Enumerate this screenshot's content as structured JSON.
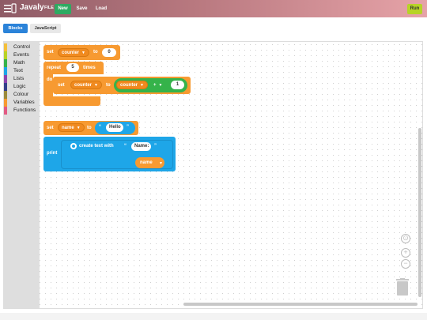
{
  "header": {
    "app_title": "Javaly",
    "file_label": "FILE",
    "new_label": "New",
    "save_label": "Save",
    "load_label": "Load",
    "run_label": "Run",
    "colors": {
      "gradient_start": "#8e5b66",
      "gradient_end": "#e6a3a8",
      "new": "#2eaa62",
      "run": "#b7d326"
    }
  },
  "tabs": {
    "blocks_label": "Blocks",
    "javascript_label": "JavaScript",
    "active": "Blocks"
  },
  "toolbox": {
    "categories": [
      {
        "label": "Control",
        "color": "#f4bf3a"
      },
      {
        "label": "Events",
        "color": "#b8d326"
      },
      {
        "label": "Math",
        "color": "#35b34a"
      },
      {
        "label": "Text",
        "color": "#1ea6e8"
      },
      {
        "label": "Lists",
        "color": "#8e44ad"
      },
      {
        "label": "Logic",
        "color": "#333f8a"
      },
      {
        "label": "Colour",
        "color": "#9b8b3c"
      },
      {
        "label": "Variables",
        "color": "#f79a31"
      },
      {
        "label": "Functions",
        "color": "#e25a84"
      }
    ]
  },
  "blocks": {
    "set1": {
      "set": "set",
      "var": "counter",
      "to": "to",
      "value": "0"
    },
    "repeat": {
      "label": "repeat",
      "count": "5",
      "times": "times",
      "do": "do"
    },
    "inner_set": {
      "set": "set",
      "var": "counter",
      "to": "to",
      "lhs": "counter",
      "op": "+",
      "rhs": "1"
    },
    "set2": {
      "set": "set",
      "var": "name",
      "to": "to",
      "open_quote": "“",
      "text": "Hello",
      "close_quote": "”"
    },
    "print": {
      "label": "print",
      "create_text_with": "create text with",
      "open_quote": "“",
      "text": "Name:",
      "close_quote": "”",
      "var": "name"
    }
  }
}
